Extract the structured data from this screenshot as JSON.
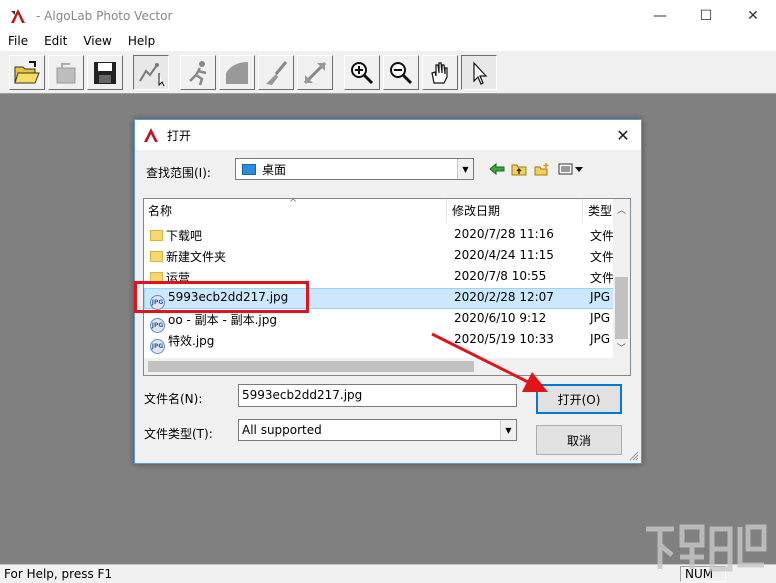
{
  "window": {
    "title": "- AlgoLab Photo Vector",
    "controls": {
      "minimize": "—",
      "maximize": "☐",
      "close": "✕"
    }
  },
  "menu": [
    "File",
    "Edit",
    "View",
    "Help"
  ],
  "toolbar": {
    "buttons": [
      "open-icon",
      "save-disabled-icon",
      "save-icon",
      "trace-icon",
      "run-icon",
      "shape-icon",
      "brush-icon",
      "line-icon",
      "zoom-in-icon",
      "zoom-out-icon",
      "hand-icon",
      "pointer-icon"
    ]
  },
  "status": {
    "help_text": "For Help, press F1",
    "num": "NUM"
  },
  "dialog": {
    "title": "打开",
    "look_in_label": "查找范围(I):",
    "look_in_value": "桌面",
    "columns": {
      "name": "名称",
      "date": "修改日期",
      "type": "类型"
    },
    "files": [
      {
        "name": "下载吧",
        "date": "2020/7/28 11:16",
        "type": "文件",
        "kind": "folder"
      },
      {
        "name": "新建文件夹",
        "date": "2020/4/24 11:15",
        "type": "文件",
        "kind": "folder"
      },
      {
        "name": "运营",
        "date": "2020/7/8 10:55",
        "type": "文件",
        "kind": "folder"
      },
      {
        "name": "5993ecb2dd217.jpg",
        "date": "2020/2/28 12:07",
        "type": "JPG",
        "kind": "jpg"
      },
      {
        "name": "oo - 副本 - 副本.jpg",
        "date": "2020/6/10 9:12",
        "type": "JPG",
        "kind": "jpg"
      },
      {
        "name": "特效.jpg",
        "date": "2020/5/19 10:33",
        "type": "JPG",
        "kind": "jpg"
      }
    ],
    "filename_label": "文件名(N):",
    "filename_value": "5993ecb2dd217.jpg",
    "filetype_label": "文件类型(T):",
    "filetype_value": "All supported",
    "open_button": "打开(O)",
    "cancel_button": "取消",
    "close": "✕"
  },
  "colors": {
    "highlight": "#e0151c",
    "workspace": "#808080",
    "selection": "#cce8ff"
  }
}
